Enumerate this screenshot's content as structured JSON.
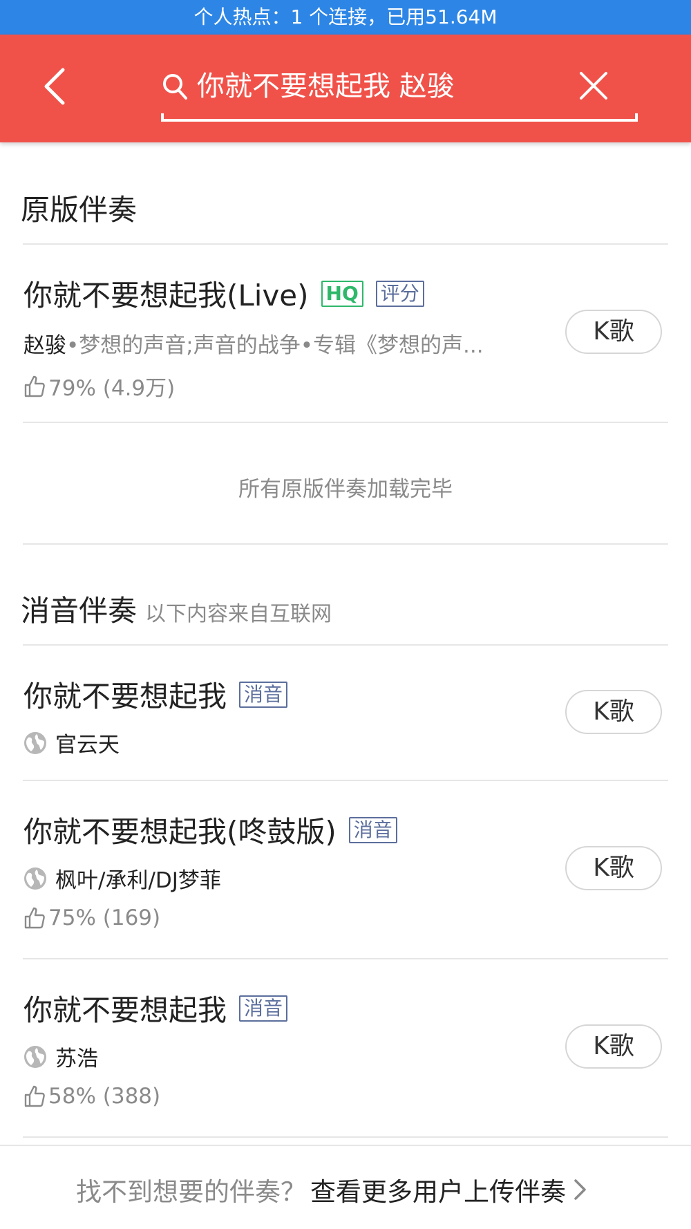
{
  "status_bar": {
    "text": "个人热点：1 个连接，已用51.64M"
  },
  "header": {
    "search_value": "你就不要想起我 赵骏"
  },
  "original_section": {
    "title": "原版伴奏",
    "songs": [
      {
        "title": "你就不要想起我(Live)",
        "tags": [
          "HQ",
          "评分"
        ],
        "artist": "赵骏",
        "detail": "•梦想的声音;声音的战争•专辑《梦想的声...",
        "rating": "79% (4.9万)",
        "button": "K歌"
      }
    ],
    "loaded_note": "所有原版伴奏加载完毕"
  },
  "muted_section": {
    "title": "消音伴奏",
    "subtitle": "以下内容来自互联网",
    "songs": [
      {
        "title": "你就不要想起我",
        "tag": "消音",
        "artist": "官云天",
        "button": "K歌"
      },
      {
        "title": "你就不要想起我(咚鼓版)",
        "tag": "消音",
        "artist": "枫叶/承利/DJ梦菲",
        "rating": "75% (169)",
        "button": "K歌"
      },
      {
        "title": "你就不要想起我",
        "tag": "消音",
        "artist": "苏浩",
        "rating": "58% (388)",
        "button": "K歌"
      }
    ]
  },
  "footer": {
    "prompt": "找不到想要的伴奏？",
    "link": "查看更多用户上传伴奏"
  },
  "colors": {
    "status_bar": "#2d86e6",
    "header": "#f0524a",
    "hq_tag": "#2fb86a",
    "tag": "#5b6e9c"
  }
}
